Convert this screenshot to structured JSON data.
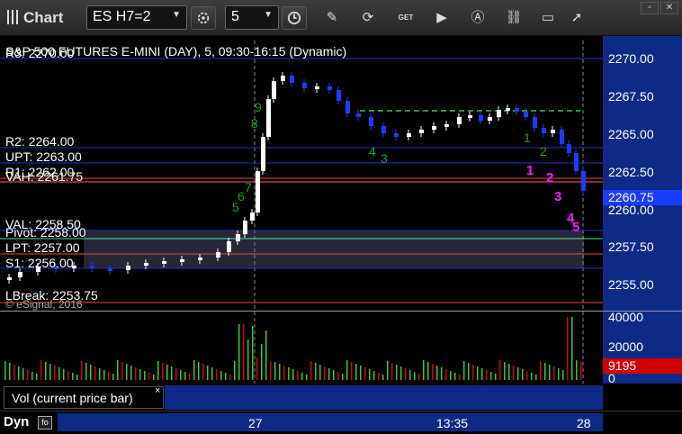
{
  "toolbar": {
    "title": "Chart",
    "symbol": "ES H7=2",
    "interval": "5",
    "icons": [
      "bars-icon",
      "symbol-search-icon",
      "settings-gear-icon",
      "clock-icon",
      "pencil-draw-icon",
      "refresh-icon",
      "get-data-icon",
      "replay-icon",
      "alert-icon",
      "link-icon",
      "comment-icon",
      "arrow-icon"
    ]
  },
  "chart": {
    "header": "S&P 500 FUTURES E-MINI (DAY), 5, 09:30-16:15 (Dynamic)",
    "header_overlap": "R3: 2270.00",
    "watermark": "© eSignal, 2016",
    "levels": {
      "r3": "R3: 2270.00",
      "r2": "R2: 2264.00",
      "upt": "UPT: 2263.00",
      "r1": "R1: 2262.00",
      "vah": "VAH: 2261.75",
      "val": "VAL: 2258.50",
      "pivot": "Pivot: 2258.00",
      "lpt": "LPT: 2257.00",
      "s1": "S1: 2256.00",
      "lbreak": "LBreak: 2253.75"
    },
    "price_ticks": [
      "2270.00",
      "2267.50",
      "2265.00",
      "2262.50",
      "2260.00",
      "2257.50",
      "2255.00"
    ],
    "last_price": "2260.75",
    "markers": [
      "1",
      "2",
      "3",
      "4",
      "5"
    ],
    "green_counts": [
      "9",
      "8",
      "7",
      "6",
      "5",
      "4",
      "3",
      "2",
      "1"
    ],
    "colors": {
      "up_candle": "#ffffff",
      "down_candle": "#1a3cff",
      "level_line": "#1f2fcf",
      "r1_line": "#ff4040",
      "vah_line": "#ff6060",
      "pivot_line": "#49e6b4",
      "value_area": "#262636",
      "last_price_tag": "#1a3cff",
      "marker": "#ff17ff",
      "td_count": "#1f9e2f"
    }
  },
  "volume": {
    "label": "Vol (current price bar)",
    "close": "×",
    "ticks": [
      "40000",
      "20000",
      "0"
    ],
    "last": "9195",
    "last_color": "#d30000"
  },
  "time_axis": {
    "dyn_label": "Dyn",
    "labels": [
      "27",
      "13:35",
      "28"
    ]
  },
  "window": {
    "buttons": [
      "restore-icon",
      "close-icon"
    ]
  }
}
